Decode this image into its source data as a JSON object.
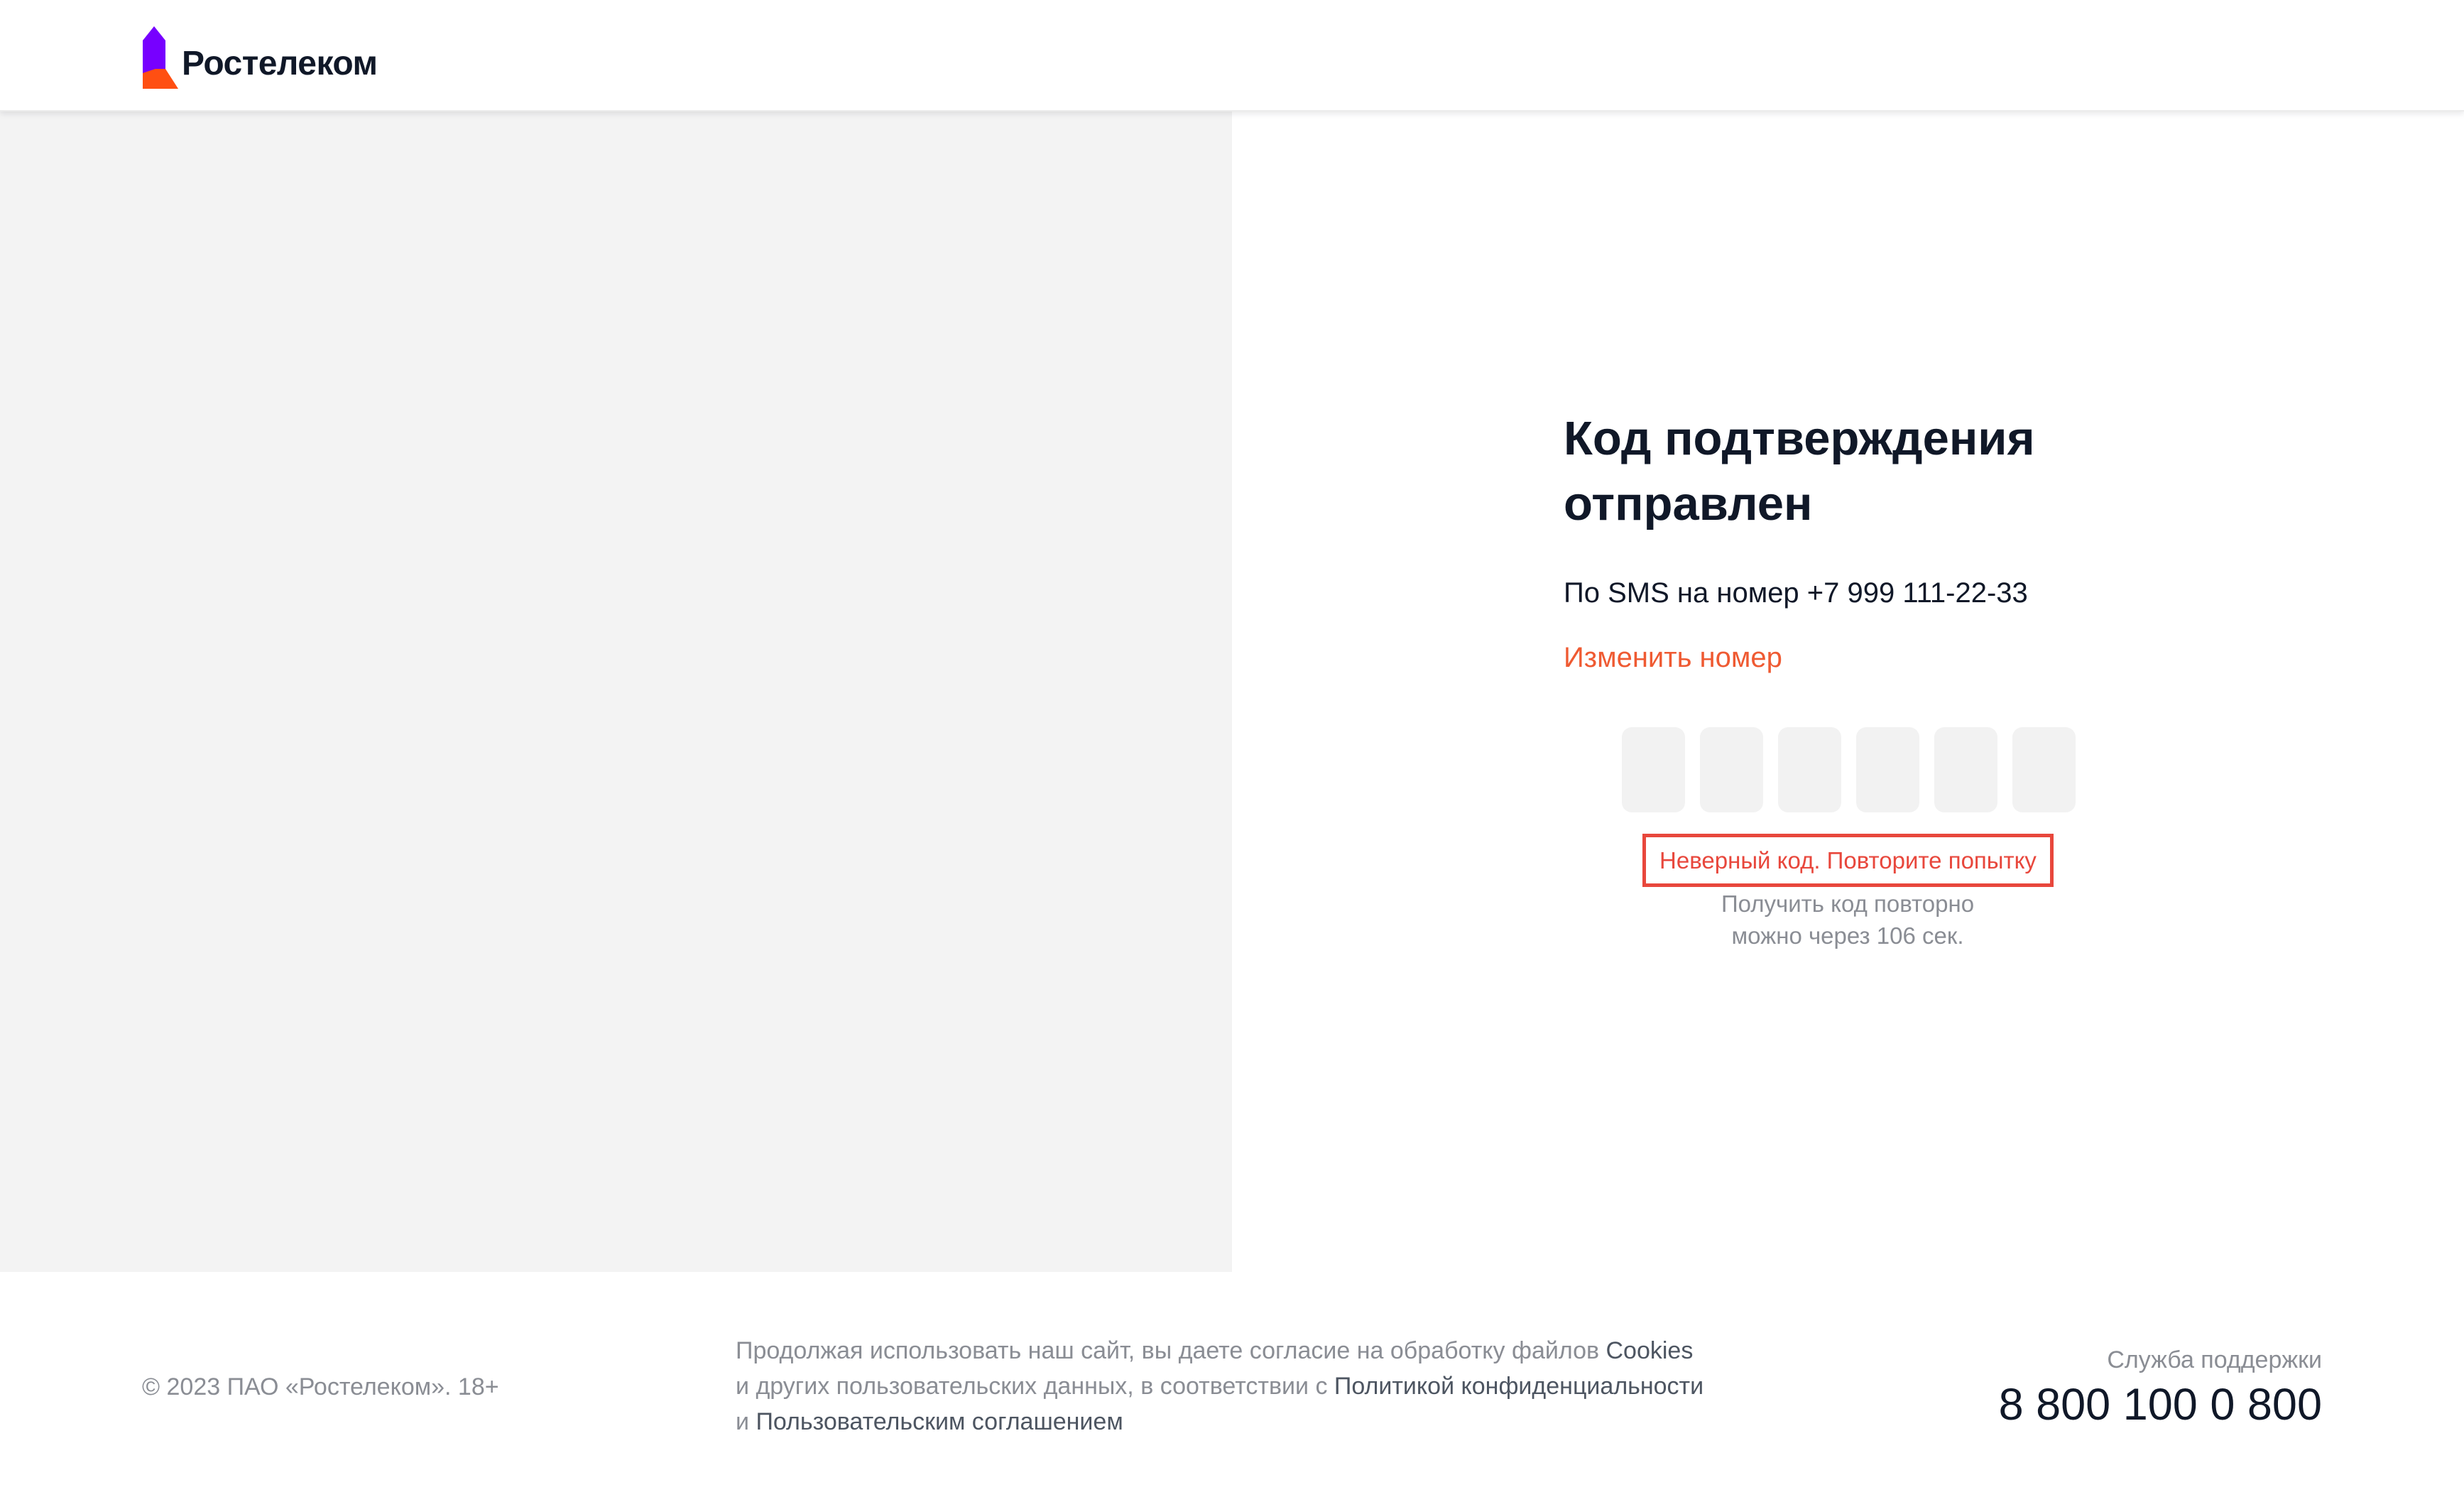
{
  "header": {
    "logo_text": "Ростелеком",
    "logo_icon": "rostelecom-logo-icon"
  },
  "verification": {
    "title": "Код подтверждения отправлен",
    "sms_text": "По SMS на номер +7 999 111-22-33",
    "change_number_label": "Изменить номер",
    "code_boxes": [
      "",
      "",
      "",
      "",
      "",
      ""
    ],
    "error_text": "Неверный код. Повторите попытку",
    "resend_line1": "Получить код повторно",
    "resend_line2": "можно через 106 сек."
  },
  "footer": {
    "copyright": "© 2023 ПАО «Ростелеком». 18+",
    "consent_part1": "Продолжая использовать наш сайт, вы даете согласие на обработку файлов ",
    "consent_link_cookies": "Cookies",
    "consent_part2": "и других пользовательских данных, в соответствии с ",
    "consent_link_privacy": "Политикой конфиденциальности",
    "consent_part3": "и ",
    "consent_link_terms": "Пользовательским соглашением",
    "support_label": "Служба поддержки",
    "support_phone": "8 800 100 0 800"
  },
  "colors": {
    "accent_orange": "#ef5a32",
    "error_red": "#e8473c",
    "logo_purple": "#7700ff",
    "text_dark": "#101828",
    "text_muted": "#8a8d94"
  }
}
